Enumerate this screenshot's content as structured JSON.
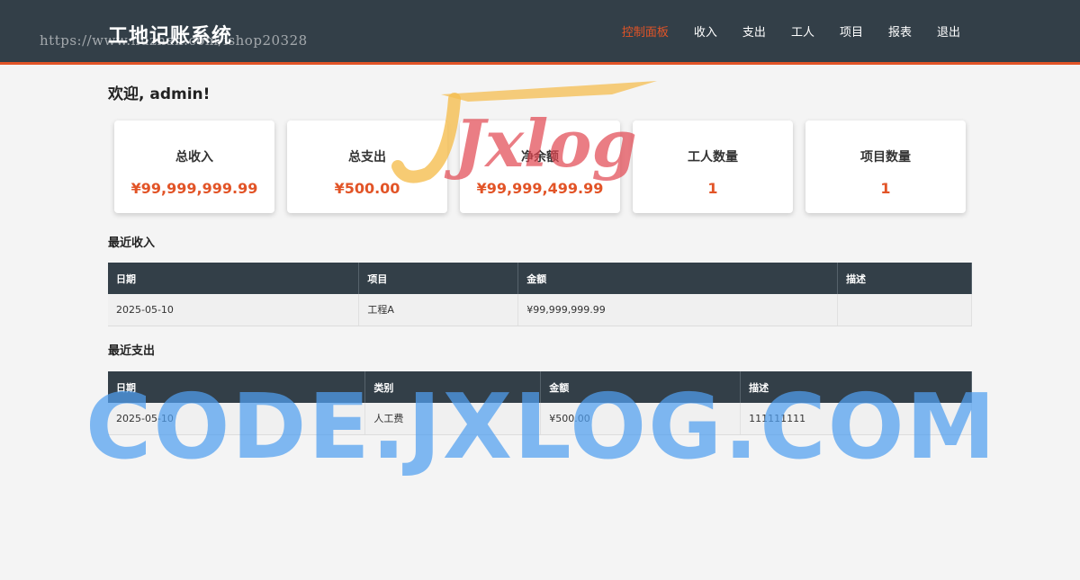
{
  "header": {
    "brand": "工地记账系统",
    "url_watermark": "https://www.huzhan.com/ishop20328",
    "nav": [
      {
        "label": "控制面板",
        "active": true
      },
      {
        "label": "收入",
        "active": false
      },
      {
        "label": "支出",
        "active": false
      },
      {
        "label": "工人",
        "active": false
      },
      {
        "label": "项目",
        "active": false
      },
      {
        "label": "报表",
        "active": false
      },
      {
        "label": "退出",
        "active": false
      }
    ]
  },
  "welcome": "欢迎, admin!",
  "stats": [
    {
      "label": "总收入",
      "value": "¥99,999,999.99"
    },
    {
      "label": "总支出",
      "value": "¥500.00"
    },
    {
      "label": "净余额",
      "value": "¥99,999,499.99"
    },
    {
      "label": "工人数量",
      "value": "1"
    },
    {
      "label": "项目数量",
      "value": "1"
    }
  ],
  "recent_income": {
    "title": "最近收入",
    "columns": [
      "日期",
      "项目",
      "金额",
      "描述"
    ],
    "rows": [
      [
        "2025-05-10",
        "工程A",
        "¥99,999,999.99",
        ""
      ]
    ]
  },
  "recent_expense": {
    "title": "最近支出",
    "columns": [
      "日期",
      "类别",
      "金额",
      "描述"
    ],
    "rows": [
      [
        "2025-05-10",
        "人工费",
        "¥500.00",
        "111111111"
      ]
    ]
  },
  "watermark": {
    "logo_text": "Jxlog",
    "big_text": "CODE.JXLOG.COM"
  },
  "colors": {
    "header_bg": "#333f48",
    "accent": "#e25427",
    "page_bg": "#f4f4f4"
  }
}
